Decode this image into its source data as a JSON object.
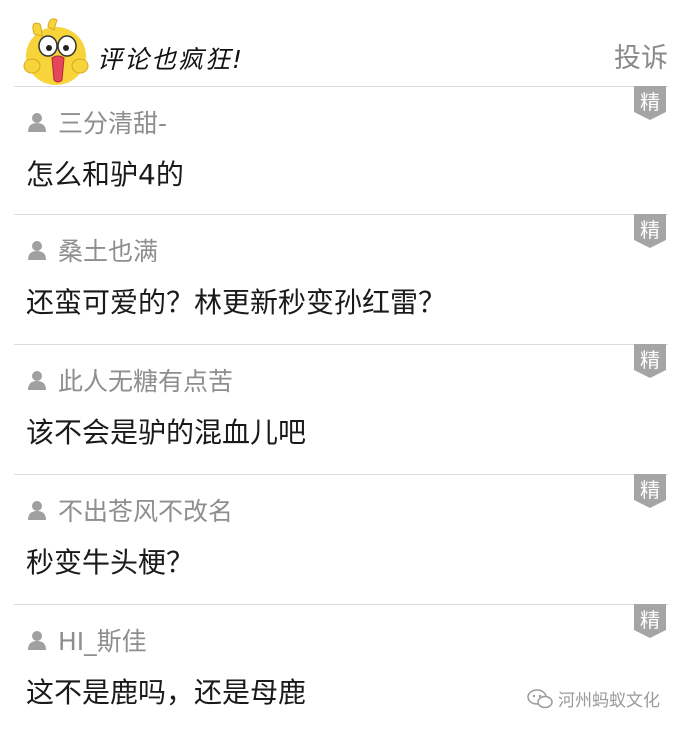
{
  "header": {
    "title": "评论也疯狂!",
    "report_label": "投诉"
  },
  "comments": [
    {
      "user": "三分清甜-",
      "text": "怎么和驴4的",
      "badge": "精"
    },
    {
      "user": "桑土也满",
      "text": "还蛮可爱的？林更新秒变孙红雷？",
      "badge": "精"
    },
    {
      "user": "此人无糖有点苦",
      "text": "该不会是驴的混血儿吧",
      "badge": "精"
    },
    {
      "user": "不出苍风不改名",
      "text": "秒变牛头梗？",
      "badge": "精"
    },
    {
      "user": "HI_斯佳",
      "text": "这不是鹿吗，还是母鹿",
      "badge": "精"
    }
  ],
  "watermark": {
    "text": "河州蚂蚁文化"
  },
  "colors": {
    "badge": "#a5a5a5",
    "divider": "#dcdcdc",
    "username": "#8e8e8e"
  }
}
